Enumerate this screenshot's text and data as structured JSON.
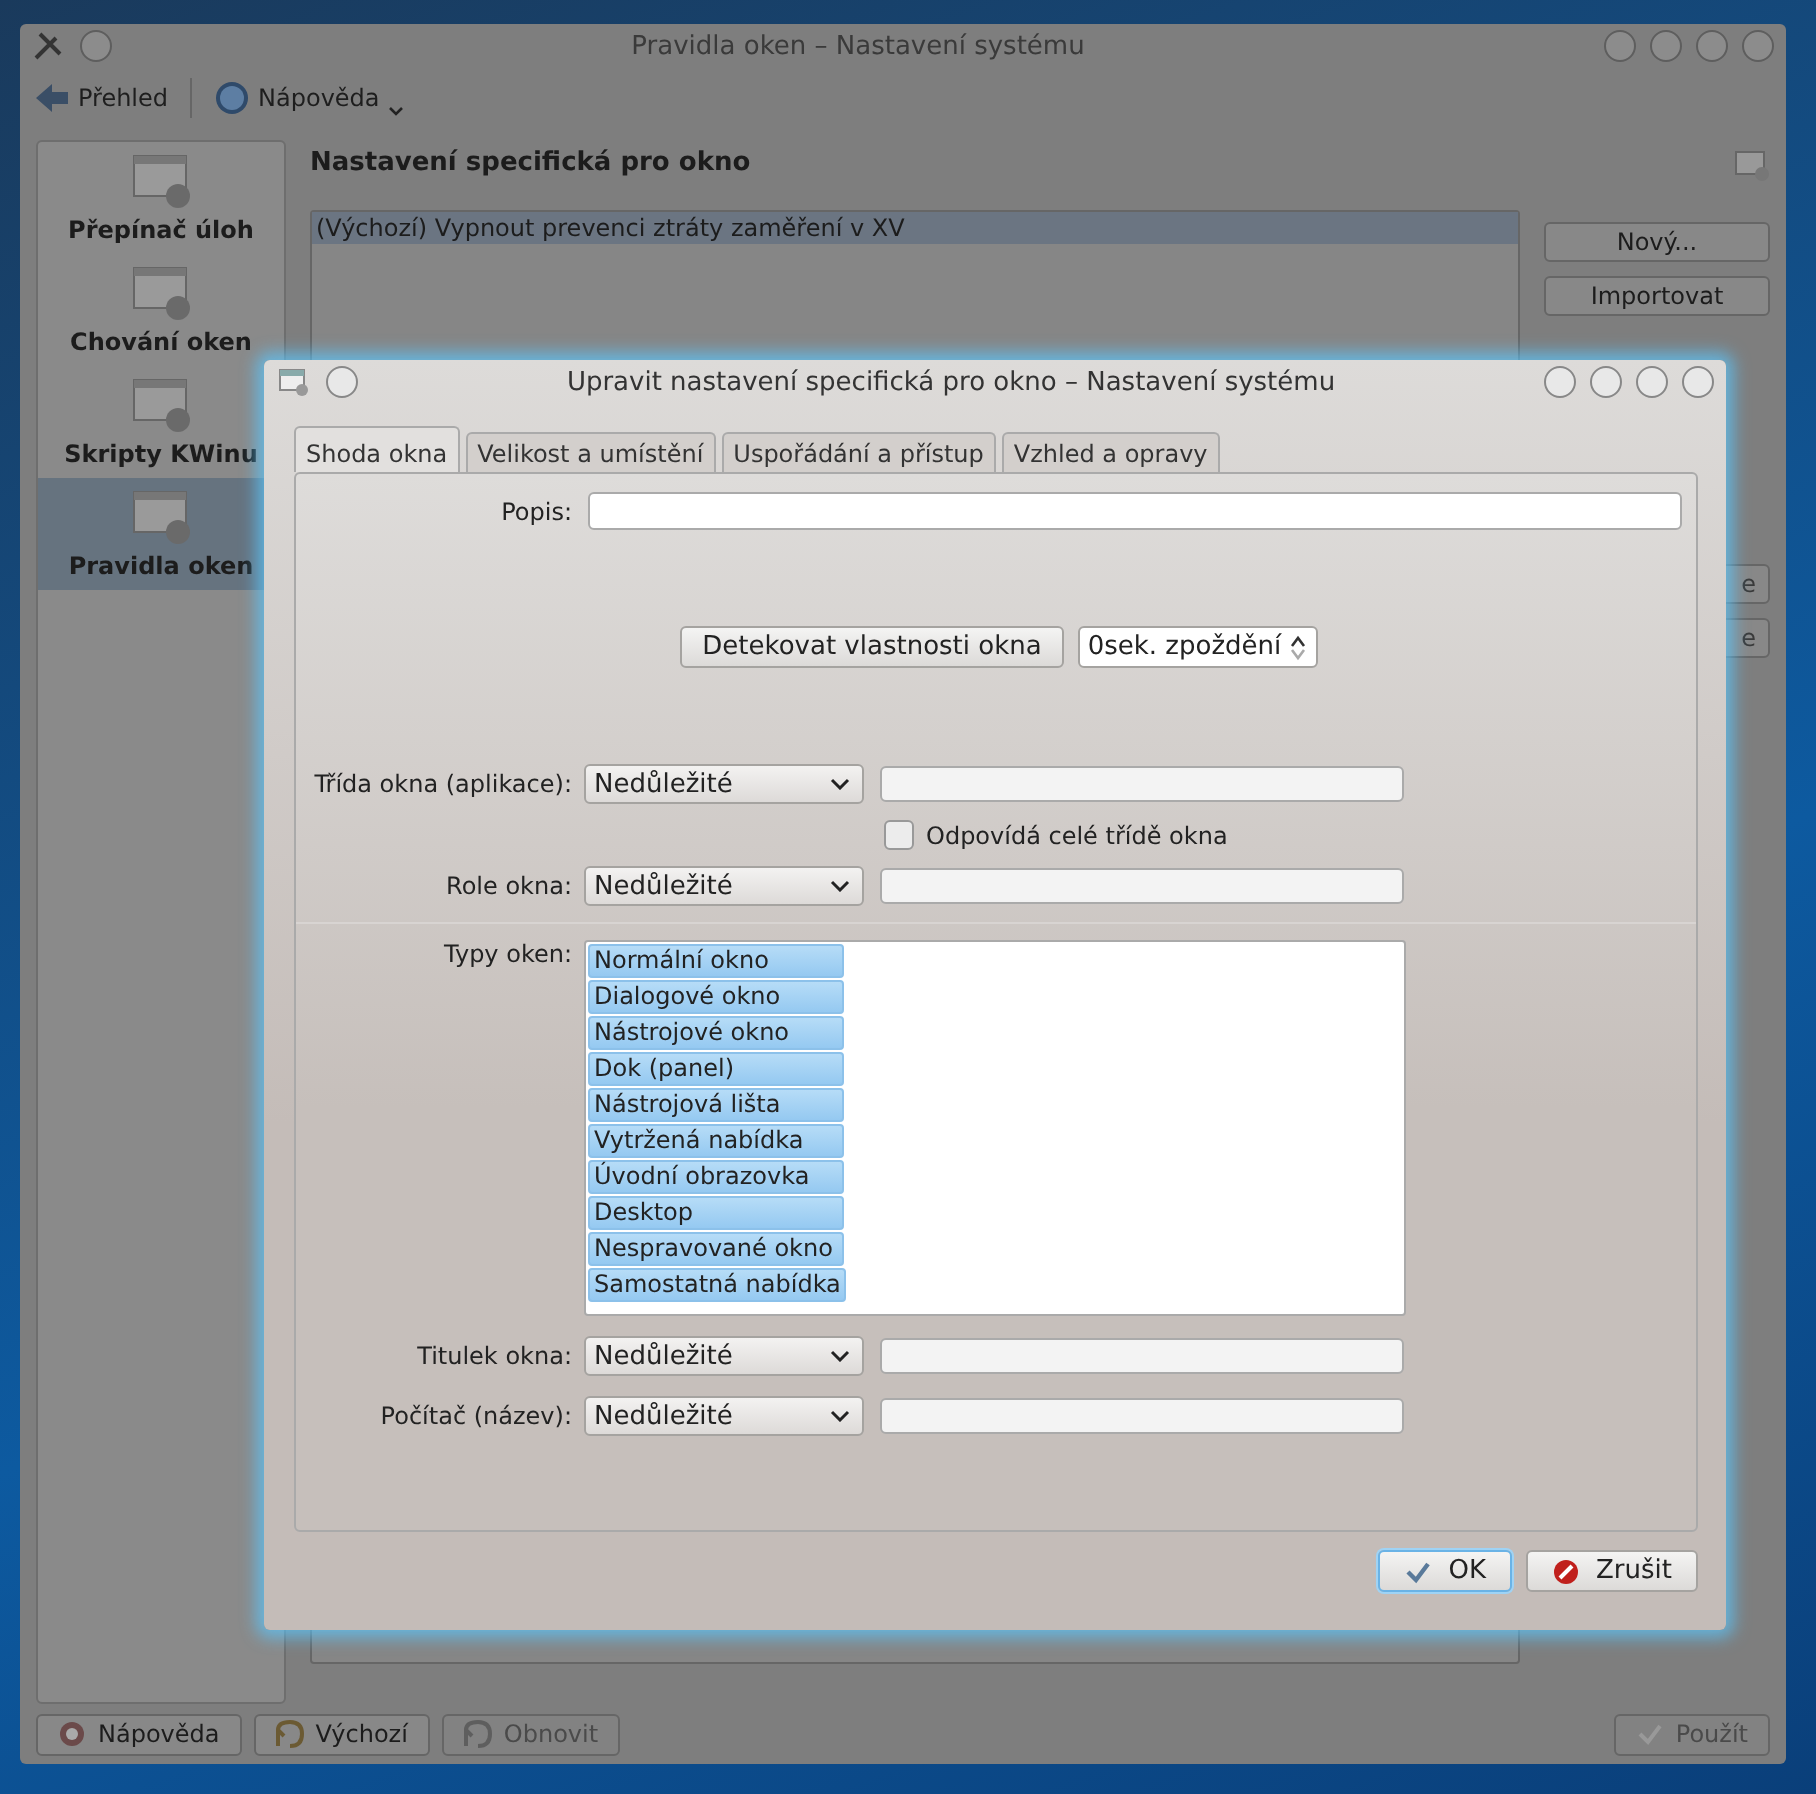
{
  "main_window": {
    "title": "Pravidla oken – Nastavení systému",
    "toolbar": [
      {
        "label": "Přehled",
        "kind": "back"
      },
      {
        "label": "Nápověda",
        "kind": "help"
      }
    ],
    "sidebar": {
      "items": [
        {
          "label": "Přepínač úloh",
          "selected": false
        },
        {
          "label": "Chování oken",
          "selected": false
        },
        {
          "label": "Skripty KWinu",
          "selected": false
        },
        {
          "label": "Pravidla oken",
          "selected": true
        }
      ]
    },
    "heading": "Nastavení specifická pro okno",
    "rules": [
      {
        "label": "(Výchozí) Vypnout prevenci ztráty zaměření v XV",
        "selected": true
      }
    ],
    "side_buttons": [
      "Nový...",
      "Importovat"
    ],
    "partial_buttons": [
      "e",
      "e"
    ],
    "bottom_buttons": [
      {
        "label": "Nápověda",
        "kind": "help",
        "disabled": false
      },
      {
        "label": "Výchozí",
        "kind": "default",
        "disabled": false
      },
      {
        "label": "Obnovit",
        "kind": "reset",
        "disabled": true
      },
      {
        "label": "Použít",
        "kind": "apply",
        "disabled": true
      }
    ]
  },
  "dialog": {
    "title": "Upravit nastavení specifická pro okno – Nastavení systému",
    "tabs": [
      {
        "label": "Shoda okna",
        "selected": true
      },
      {
        "label": "Velikost a umístění",
        "selected": false
      },
      {
        "label": "Uspořádání a přístup",
        "selected": false
      },
      {
        "label": "Vzhled a opravy",
        "selected": false
      }
    ],
    "description_label": "Popis:",
    "detect_button": "Detekovat vlastnosti okna",
    "delay": "0sek. zpoždění",
    "class_row": {
      "label": "Třída okna (aplikace):",
      "match": "Nedůležité"
    },
    "whole_class": {
      "label": "Odpovídá celé třídě okna",
      "checked": false
    },
    "role_row": {
      "label": "Role okna:",
      "match": "Nedůležité"
    },
    "types": {
      "label": "Typy oken:",
      "items": [
        {
          "label": "Normální okno",
          "selected": true
        },
        {
          "label": "Dialogové okno",
          "selected": true
        },
        {
          "label": "Nástrojové okno",
          "selected": true
        },
        {
          "label": "Dok (panel)",
          "selected": true
        },
        {
          "label": "Nástrojová lišta",
          "selected": true
        },
        {
          "label": "Vytržená nabídka",
          "selected": true
        },
        {
          "label": "Úvodní obrazovka",
          "selected": true
        },
        {
          "label": "Desktop",
          "selected": true
        },
        {
          "label": "Nespravované okno",
          "selected": true
        },
        {
          "label": "Samostatná nabídka",
          "selected": true
        }
      ]
    },
    "title_row": {
      "label": "Titulek okna:",
      "match": "Nedůležité"
    },
    "machine_row": {
      "label": "Počítač (název):",
      "match": "Nedůležité"
    },
    "buttons": [
      {
        "label": "OK",
        "kind": "ok",
        "default": true
      },
      {
        "label": "Zrušit",
        "kind": "cancel",
        "default": false
      }
    ]
  }
}
